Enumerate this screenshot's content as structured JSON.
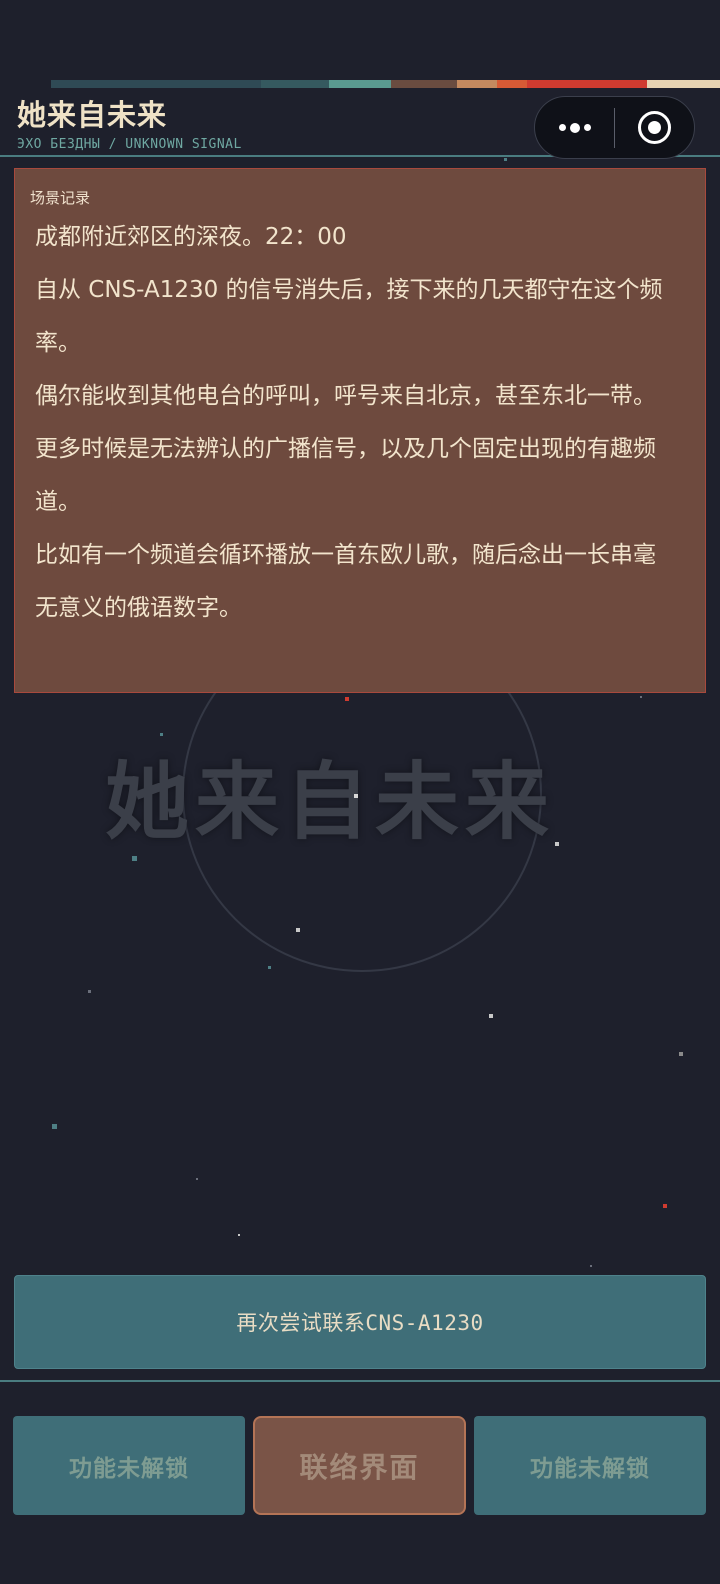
{
  "header": {
    "title": "她来自未来",
    "subtitle": "ЭХО БЕЗДНЫ / UNKNOWN SIGNAL",
    "stripe_colors": [
      "#2f4a55",
      "#35595f",
      "#5a9a90",
      "#6a4c40",
      "#c58a5f",
      "#d75a35",
      "#cf3b30",
      "#e6d3b2"
    ]
  },
  "capsule": {
    "more_icon": "more-dots-icon",
    "close_icon": "target-circle-icon"
  },
  "scene": {
    "label": "场景记录",
    "paragraphs": [
      "成都附近郊区的深夜。22：00",
      "自从 CNS-A1230 的信号消失后，接下来的几天都守在这个频率。",
      "偶尔能收到其他电台的呼叫，呼号来自北京，甚至东北一带。",
      "更多时候是无法辨认的广播信号，以及几个固定出现的有趣频道。",
      "比如有一个频道会循环播放一首东欧儿歌，随后念出一长串毫无意义的俄语数字。"
    ]
  },
  "background": {
    "watermark_title": "她来自未来"
  },
  "actions": {
    "retry_label": "再次尝试联系CNS-A1230"
  },
  "tabs": [
    {
      "label": "功能未解锁",
      "state": "locked"
    },
    {
      "label": "联络界面",
      "state": "active"
    },
    {
      "label": "功能未解锁",
      "state": "locked"
    }
  ],
  "colors": {
    "background": "#1e202c",
    "panel": "#6e4a3e",
    "accent_teal": "#3f6e78",
    "accent_red": "#cf3b30"
  }
}
